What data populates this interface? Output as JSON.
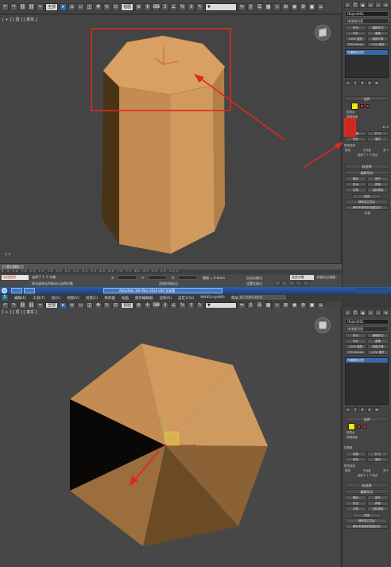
{
  "colors": {
    "viewport_bg": "#444444",
    "object_side_lit": "#D09A5E",
    "object_side_dark": "#4A3418",
    "object_top": "#D9A063",
    "annotation_red": "#E0281E",
    "panel_bg": "#444444"
  },
  "top_screen": {
    "toolbar": {
      "mode_dropdown": "全部",
      "named_selection": "▼"
    },
    "viewport": {
      "label": "[ + ] [ 透 ] [ 真实 ]",
      "viewcube": "viewcube-icon",
      "axis_label": "y\nx"
    },
    "panel": {
      "tabs": [
        "+",
        "⌒",
        "▣",
        "◎",
        "▭",
        "⚒"
      ],
      "object_name": "Object001",
      "modifier_list": "修改器列表",
      "buttons": [
        "挤出",
        "编辑多边",
        "切片",
        "晶格",
        "UVW 贴图",
        "网格平滑",
        "FFD 4x4x4",
        "UVW 展开"
      ],
      "stack_item": "可编辑多边形",
      "stack_icons": [
        "⇤",
        "|",
        "∀",
        "⊘",
        "⊞"
      ],
      "selection_header": "选择",
      "by_vertex": "按顶点",
      "ignore_backfacing": "忽略背面",
      "by_angle": "按角度",
      "by_angle_value": "45.0",
      "shrink": "收缩",
      "grow": "扩大",
      "ring": "环形",
      "loop": "循环",
      "preview_selection": "预览选择",
      "disabled": "禁用",
      "subobject": "子对象",
      "multiple": "多个",
      "selected_count": "选择了 7 个顶点",
      "soft_selection": "软选择",
      "edit_vertices": "编辑顶点",
      "remove": "移除",
      "break": "断开",
      "extrude": "挤出",
      "weld": "焊接",
      "chamfer": "切角",
      "target_weld": "目标焊接",
      "connect": "连接",
      "remove_isolated": "移除孤立顶点",
      "remove_unused_map": "移除未使用的贴图顶点",
      "weight": "权重"
    },
    "timeline": {
      "frame": "0 / 100",
      "ticks": "0 5 10 15 20 25 30 35 40 45 50 55 60 65 70 75 80 85 90 95 100"
    },
    "status": {
      "maxscript": "欢迎使用",
      "message1": "选择了 1 个 对象",
      "message2": "单击或单击并拖动以选择对象",
      "x_label": "X:",
      "y_label": "Y:",
      "z_label": "Z:",
      "grid": "栅格 = 0.0mm",
      "auto_key": "自动关键点",
      "selected_set": "选定对象",
      "set_key": "设置关键点",
      "key_filters": "关键点过滤器...",
      "add_time_tag": "添加时间标记"
    },
    "taskbar": {
      "app_title": "Autodesk 3ds Max 2014 x64   无标题"
    }
  },
  "bottom_screen": {
    "titlebar": {
      "logo": "S",
      "menus": [
        "编辑(E)",
        "工具(T)",
        "组(G)",
        "视图(V)",
        "创建(C)",
        "修改器",
        "动画",
        "图形编辑器",
        "渲染(R)",
        "自定义(U)",
        "MAXScript(M)",
        "帮助(H)"
      ],
      "search": "键入关键字或短语"
    },
    "toolbar": {
      "mode_dropdown": "全部",
      "view_dropdown": "视图"
    },
    "viewport": {
      "label": "[ + ] [ 顶 ] [ 真实 ]",
      "viewcube": "viewcube-icon"
    },
    "panel": {
      "object_name": "Object001",
      "modifier_list": "修改器列表",
      "buttons": [
        "挤出",
        "编辑多边",
        "切片",
        "晶格",
        "UVW 贴图",
        "网格平滑",
        "FFD 4x4x4",
        "UVW 展开"
      ],
      "stack_item": "可编辑多边形",
      "selection_header": "选择",
      "by_vertex": "按顶点",
      "ignore_backfacing": "忽略背面",
      "by_angle": "按角度",
      "shrink": "收缩",
      "grow": "扩大",
      "ring": "环形",
      "loop": "循环",
      "preview_selection": "预览选择",
      "disabled": "禁用",
      "subobject": "子对象",
      "multiple": "多个",
      "selected_count": "选择了 1 个顶点",
      "soft_selection": "软选择",
      "edit_vertices": "编辑顶点",
      "remove": "移除",
      "break": "断开",
      "extrude": "挤出",
      "weld": "焊接",
      "chamfer": "切角",
      "target_weld": "目标焊接",
      "connect": "连接",
      "remove_isolated": "移除孤立顶点",
      "remove_unused_map": "移除未使用的贴图顶点"
    }
  }
}
